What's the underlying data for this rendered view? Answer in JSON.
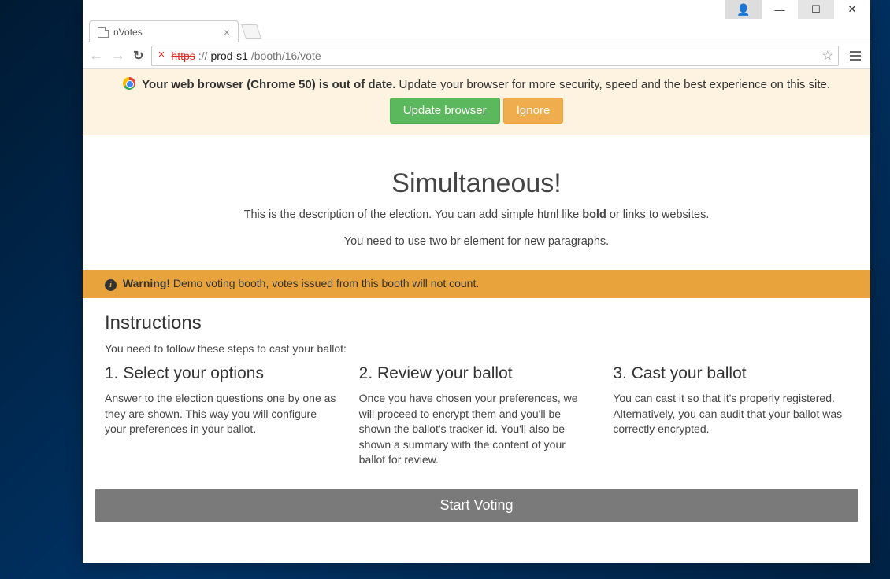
{
  "window": {
    "tab_title": "nVotes",
    "url_struck": "https",
    "url_scheme_tail": "://",
    "url_host": "prod-s1",
    "url_path": "/booth/16/vote"
  },
  "outdated": {
    "bold": "Your web browser (Chrome 50) is out of date.",
    "rest": " Update your browser for more security, speed and the best experience on this site.",
    "update_label": "Update browser",
    "ignore_label": "Ignore"
  },
  "election": {
    "title": "Simultaneous!",
    "desc_pre": "This is the description of the election. You can add simple html like ",
    "desc_bold": "bold",
    "desc_mid": " or ",
    "desc_link": "links to websites",
    "desc_post": ".",
    "desc2": "You need to use two br element for new paragraphs."
  },
  "warning": {
    "label": "Warning!",
    "text": " Demo voting booth, votes issued from this booth will not count."
  },
  "instructions": {
    "heading": "Instructions",
    "lead": "You need to follow these steps to cast your ballot:",
    "steps": [
      {
        "title": "1. Select your options",
        "text": "Answer to the election questions one by one as they are shown. This way you will configure your preferences in your ballot."
      },
      {
        "title": "2. Review your ballot",
        "text": "Once you have chosen your preferences, we will proceed to encrypt them and you'll be shown the ballot's tracker id. You'll also be shown a summary with the content of your ballot for review."
      },
      {
        "title": "3. Cast your ballot",
        "text": "You can cast it so that it's properly registered. Alternatively, you can audit that your ballot was correctly encrypted."
      }
    ]
  },
  "start": {
    "label": "Start Voting"
  }
}
